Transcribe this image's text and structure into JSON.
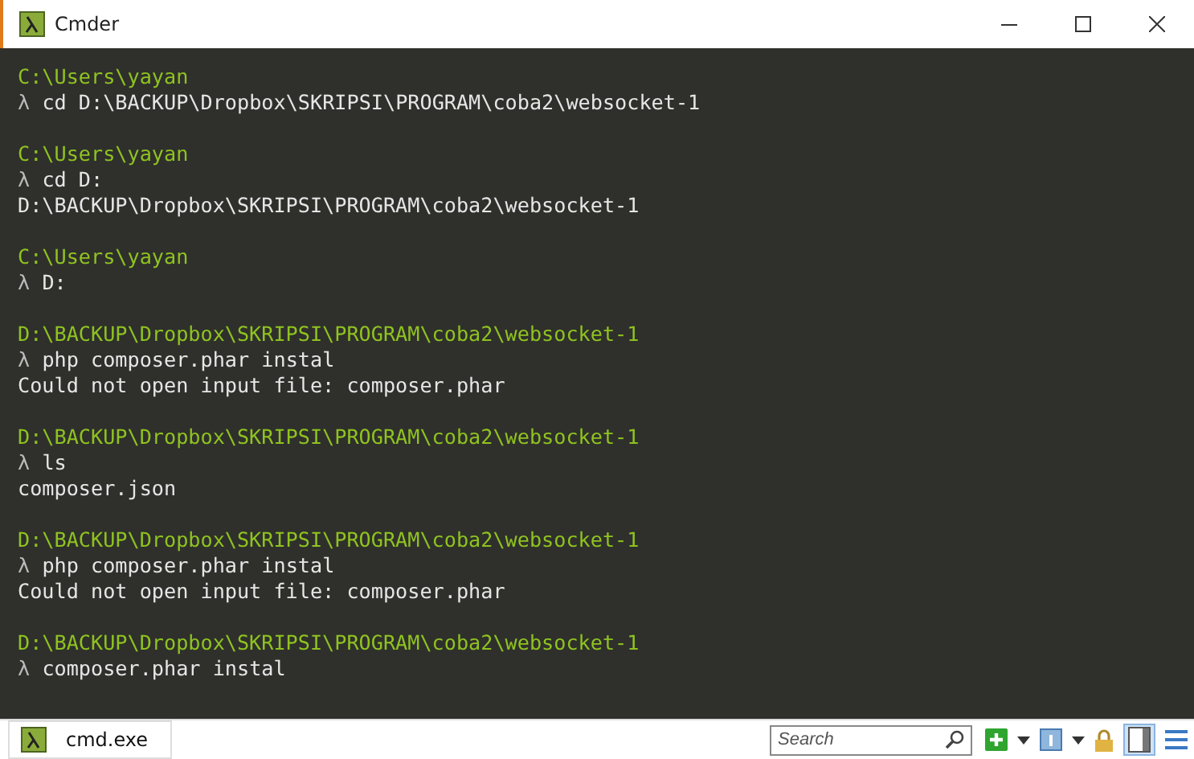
{
  "window": {
    "title": "Cmder"
  },
  "terminal": {
    "lines": [
      {
        "kind": "path",
        "text": "C:\\Users\\yayan"
      },
      {
        "kind": "command",
        "prompt": "λ",
        "text": "cd D:\\BACKUP\\Dropbox\\SKRIPSI\\PROGRAM\\coba2\\websocket-1"
      },
      {
        "kind": "blank"
      },
      {
        "kind": "path",
        "text": "C:\\Users\\yayan"
      },
      {
        "kind": "command",
        "prompt": "λ",
        "text": "cd D:"
      },
      {
        "kind": "output",
        "text": "D:\\BACKUP\\Dropbox\\SKRIPSI\\PROGRAM\\coba2\\websocket-1"
      },
      {
        "kind": "blank"
      },
      {
        "kind": "path",
        "text": "C:\\Users\\yayan"
      },
      {
        "kind": "command",
        "prompt": "λ",
        "text": "D:"
      },
      {
        "kind": "blank"
      },
      {
        "kind": "path",
        "text": "D:\\BACKUP\\Dropbox\\SKRIPSI\\PROGRAM\\coba2\\websocket-1"
      },
      {
        "kind": "command",
        "prompt": "λ",
        "text": "php composer.phar instal"
      },
      {
        "kind": "output",
        "text": "Could not open input file: composer.phar"
      },
      {
        "kind": "blank"
      },
      {
        "kind": "path",
        "text": "D:\\BACKUP\\Dropbox\\SKRIPSI\\PROGRAM\\coba2\\websocket-1"
      },
      {
        "kind": "command",
        "prompt": "λ",
        "text": "ls"
      },
      {
        "kind": "output",
        "text": "composer.json"
      },
      {
        "kind": "blank"
      },
      {
        "kind": "path",
        "text": "D:\\BACKUP\\Dropbox\\SKRIPSI\\PROGRAM\\coba2\\websocket-1"
      },
      {
        "kind": "command",
        "prompt": "λ",
        "text": "php composer.phar instal"
      },
      {
        "kind": "output",
        "text": "Could not open input file: composer.phar"
      },
      {
        "kind": "blank"
      },
      {
        "kind": "path",
        "text": "D:\\BACKUP\\Dropbox\\SKRIPSI\\PROGRAM\\coba2\\websocket-1"
      },
      {
        "kind": "command",
        "prompt": "λ",
        "text": "composer.phar instal"
      }
    ]
  },
  "tabs": [
    {
      "label": "cmd.exe",
      "selected": true
    }
  ],
  "search": {
    "placeholder": "Search"
  }
}
